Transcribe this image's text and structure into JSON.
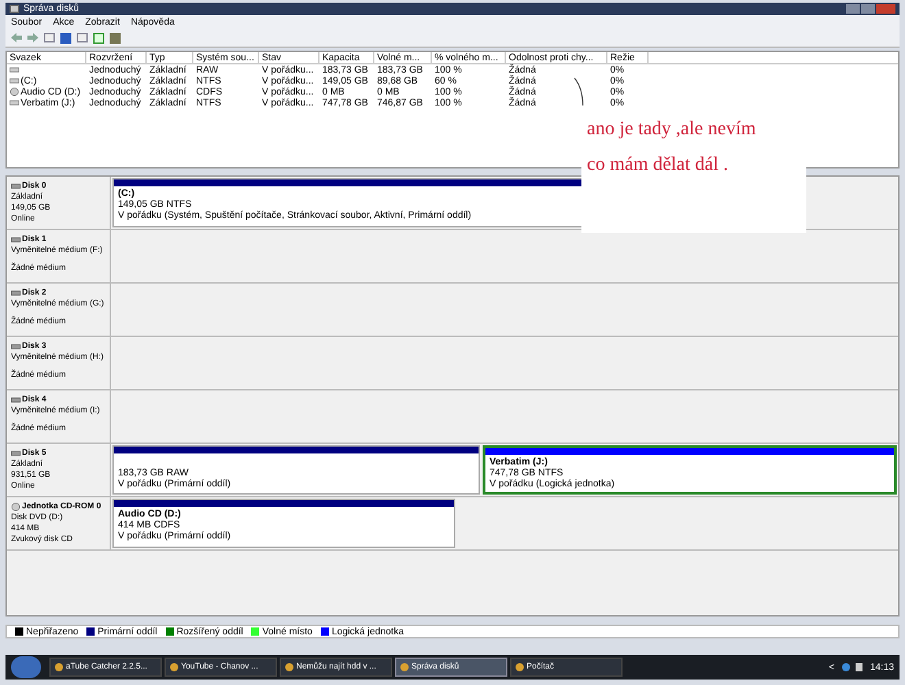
{
  "window": {
    "title": "Správa disků"
  },
  "menu": [
    "Soubor",
    "Akce",
    "Zobrazit",
    "Nápověda"
  ],
  "volumes": {
    "columns": [
      "Svazek",
      "Rozvržení",
      "Typ",
      "Systém sou...",
      "Stav",
      "Kapacita",
      "Volné m...",
      "% volného m...",
      "Odolnost proti chy...",
      "Režie"
    ],
    "rows": [
      {
        "cells": [
          "",
          "Jednoduchý",
          "Základní",
          "RAW",
          "V pořádku...",
          "183,73 GB",
          "183,73 GB",
          "100 %",
          "Žádná",
          "0%"
        ]
      },
      {
        "cells": [
          "(C:)",
          "Jednoduchý",
          "Základní",
          "NTFS",
          "V pořádku...",
          "149,05 GB",
          "89,68 GB",
          "60 %",
          "Žádná",
          "0%"
        ]
      },
      {
        "cells": [
          "Audio CD (D:)",
          "Jednoduchý",
          "Základní",
          "CDFS",
          "V pořádku...",
          "0 MB",
          "0 MB",
          "100 %",
          "Žádná",
          "0%"
        ],
        "kind": "cd"
      },
      {
        "cells": [
          "Verbatim (J:)",
          "Jednoduchý",
          "Základní",
          "NTFS",
          "V pořádku...",
          "747,78 GB",
          "746,87 GB",
          "100 %",
          "Žádná",
          "0%"
        ]
      }
    ]
  },
  "annotation": [
    "ano je tady ,ale nevím",
    "co mám dělat dál ."
  ],
  "disks": [
    {
      "name": "Disk 0",
      "lines": [
        "Základní",
        "149,05 GB",
        "Online"
      ],
      "partitions": [
        {
          "kind": "primary",
          "title": "(C:)",
          "lines": [
            "149,05 GB NTFS",
            "V pořádku (Systém, Spuštění počítače, Stránkovací soubor, Aktivní, Primární oddíl)"
          ],
          "selected": false
        }
      ]
    },
    {
      "name": "Disk 1",
      "lines": [
        "Vyměnitelné médium (F:)",
        "Žádné médium"
      ]
    },
    {
      "name": "Disk 2",
      "lines": [
        "Vyměnitelné médium (G:)",
        "Žádné médium"
      ]
    },
    {
      "name": "Disk 3",
      "lines": [
        "Vyměnitelné médium (H:)",
        "Žádné médium"
      ]
    },
    {
      "name": "Disk 4",
      "lines": [
        "Vyměnitelné médium (I:)",
        "Žádné médium"
      ]
    },
    {
      "name": "Disk 5",
      "lines": [
        "Základní",
        "931,51 GB",
        "Online"
      ],
      "partitions": [
        {
          "kind": "primary",
          "lines": [
            "183,73 GB RAW",
            "V pořádku (Primární oddíl)"
          ],
          "selected": false
        },
        {
          "kind": "logical",
          "title": "Verbatim  (J:)",
          "lines": [
            "747,78 GB NTFS",
            "V pořádku (Logická jednotka)"
          ],
          "selected": true
        }
      ]
    },
    {
      "name": "Jednotka CD-ROM 0",
      "kind": "cd",
      "lines": [
        "Disk DVD (D:)",
        "414 MB",
        "Zvukový disk CD"
      ],
      "partitions": [
        {
          "kind": "primary",
          "title": "Audio CD  (D:)",
          "lines": [
            "414 MB CDFS",
            "V pořádku (Primární oddíl)"
          ],
          "selected": false
        }
      ]
    }
  ],
  "legend": [
    {
      "label": "Nepřiřazeno",
      "color": "#000000"
    },
    {
      "label": "Primární oddíl",
      "color": "#000080"
    },
    {
      "label": "Rozšířený oddíl",
      "color": "#008000"
    },
    {
      "label": "Volné místo",
      "color": "#33ff33"
    },
    {
      "label": "Logická jednotka",
      "color": "#0000ff"
    }
  ],
  "taskbar": {
    "items": [
      {
        "label": "aTube Catcher 2.2.5...",
        "selected": false
      },
      {
        "label": "YouTube - Chanov ...",
        "selected": false
      },
      {
        "label": "Nemůžu najít hdd v ...",
        "selected": false
      },
      {
        "label": "Správa disků",
        "selected": true
      },
      {
        "label": "Počítač",
        "selected": false
      }
    ],
    "chevron": "<",
    "clock": "14:13"
  }
}
